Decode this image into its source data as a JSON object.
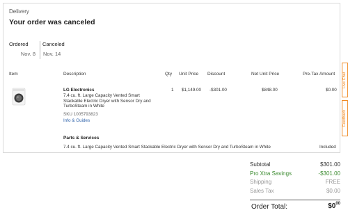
{
  "header": {
    "section_label": "Delivery",
    "headline": "Your order was canceled"
  },
  "timeline": [
    {
      "label": "Ordered",
      "date": "Nov. 8"
    },
    {
      "label": "Canceled",
      "date": "Nov. 14"
    }
  ],
  "table": {
    "columns": {
      "item": "Item",
      "description": "Description",
      "qty": "Qty",
      "unit_price": "Unit Price",
      "discount": "Discount",
      "net_unit_price": "Net Unit Price",
      "pre_tax_amount": "Pre-Tax Amount"
    },
    "row": {
      "brand": "LG Electronics",
      "title": "7.4 cu. ft. Large Capacity Vented Smart Stackable Electric Dryer with Sensor Dry and TurboSteam in White",
      "sku": "SKU 1005793823",
      "guides_link": "Info & Guides",
      "qty": "1",
      "unit_price": "$1,149.00",
      "discount": "-$301.00",
      "net_unit_price": "$848.00",
      "pre_tax_amount": "$0.00"
    }
  },
  "parts_services": {
    "heading": "Parts & Services",
    "description": "7.4 cu. ft. Large Capacity Vented Smart Stackable Electric Dryer with Sensor Dry and TurboSteam in White",
    "status": "Included"
  },
  "summary": {
    "subtotal_label": "Subtotal",
    "subtotal_value": "$301.00",
    "savings_label": "Pro Xtra Savings",
    "savings_value": "-$301.00",
    "shipping_label": "Shipping",
    "shipping_value": "FREE",
    "tax_label": "Sales Tax",
    "tax_value": "$0.00",
    "total_label": "Order Total:",
    "total_dollars": "$0",
    "total_cents": "00"
  },
  "side_tabs": {
    "chat": "Live Chat",
    "feedback": "Feedback"
  },
  "colors": {
    "accent_orange": "#f08a24",
    "link_blue": "#2a5fa8",
    "savings_green": "#3a8a2e"
  }
}
